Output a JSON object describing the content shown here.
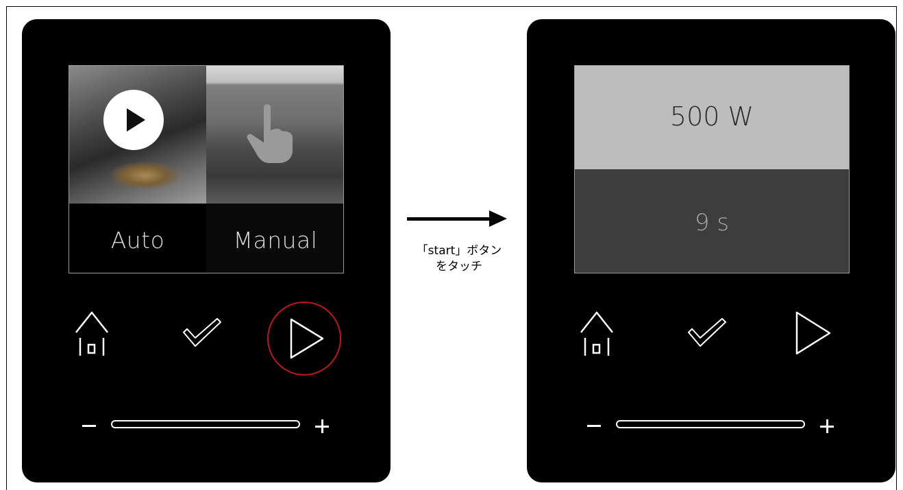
{
  "left_panel": {
    "screen": {
      "auto_label": "Auto",
      "manual_label": "Manual"
    },
    "controls": {
      "home_icon": "home-icon",
      "confirm_icon": "checkmark-icon",
      "start_icon": "play-icon",
      "start_highlight_color": "#c0161e"
    },
    "slider": {
      "minus_icon": "minus-icon",
      "plus_icon": "plus-icon"
    }
  },
  "transition": {
    "caption_line1": "「start」ボタン",
    "caption_line2": "をタッチ"
  },
  "right_panel": {
    "screen": {
      "power_value": "500 W",
      "time_value": "9 s"
    },
    "controls": {
      "home_icon": "home-icon",
      "confirm_icon": "checkmark-icon",
      "start_icon": "play-icon"
    },
    "slider": {
      "minus_icon": "minus-icon",
      "plus_icon": "plus-icon"
    }
  },
  "colors": {
    "device_body": "#000000",
    "power_band": "#bdbdbd",
    "time_band": "#3d3d3d",
    "highlight": "#c0161e"
  }
}
